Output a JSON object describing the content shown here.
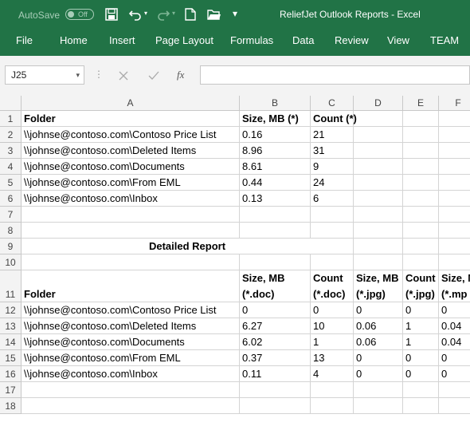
{
  "window": {
    "autosave_label": "AutoSave",
    "autosave_state": "Off",
    "title": "ReliefJet Outlook Reports  -  Excel"
  },
  "ribbon": {
    "tabs": [
      "File",
      "Home",
      "Insert",
      "Page Layout",
      "Formulas",
      "Data",
      "Review",
      "View",
      "TEAM"
    ]
  },
  "formula_bar": {
    "name_box": "J25",
    "fx": "fx",
    "value": ""
  },
  "sheet": {
    "columns": [
      "A",
      "B",
      "C",
      "D",
      "E",
      "F"
    ],
    "rows": [
      {
        "n": "1",
        "cells": [
          "Folder",
          "Size, MB (*)",
          "Count (*)",
          "",
          "",
          ""
        ]
      },
      {
        "n": "2",
        "cells": [
          "\\\\johnse@contoso.com\\Contoso Price List",
          "0.16",
          "21",
          "",
          "",
          ""
        ]
      },
      {
        "n": "3",
        "cells": [
          "\\\\johnse@contoso.com\\Deleted Items",
          "8.96",
          "31",
          "",
          "",
          ""
        ]
      },
      {
        "n": "4",
        "cells": [
          "\\\\johnse@contoso.com\\Documents",
          "8.61",
          "9",
          "",
          "",
          ""
        ]
      },
      {
        "n": "5",
        "cells": [
          "\\\\johnse@contoso.com\\From EML",
          "0.44",
          "24",
          "",
          "",
          ""
        ]
      },
      {
        "n": "6",
        "cells": [
          "\\\\johnse@contoso.com\\Inbox",
          "0.13",
          "6",
          "",
          "",
          ""
        ]
      },
      {
        "n": "7",
        "cells": [
          "",
          "",
          "",
          "",
          "",
          ""
        ]
      },
      {
        "n": "8",
        "cells": [
          "",
          "",
          "",
          "",
          "",
          ""
        ]
      },
      {
        "n": "9",
        "cells": [
          "",
          "",
          "",
          "",
          "",
          ""
        ],
        "merged_title": "Detailed Report"
      },
      {
        "n": "10",
        "cells": [
          "",
          "",
          "",
          "",
          "",
          ""
        ]
      },
      {
        "n": "11",
        "cells": [
          "Folder",
          "Size, MB\n(*.doc)",
          "Count\n(*.doc)",
          "Size, MB\n(*.jpg)",
          "Count\n(*.jpg)",
          "Size, MB\n(*.mp"
        ]
      },
      {
        "n": "12",
        "cells": [
          "\\\\johnse@contoso.com\\Contoso Price List",
          "0",
          "0",
          "0",
          "0",
          "0"
        ]
      },
      {
        "n": "13",
        "cells": [
          "\\\\johnse@contoso.com\\Deleted Items",
          "6.27",
          "10",
          "0.06",
          "1",
          "0.04"
        ]
      },
      {
        "n": "14",
        "cells": [
          "\\\\johnse@contoso.com\\Documents",
          "6.02",
          "1",
          "0.06",
          "1",
          "0.04"
        ]
      },
      {
        "n": "15",
        "cells": [
          "\\\\johnse@contoso.com\\From EML",
          "0.37",
          "13",
          "0",
          "0",
          "0"
        ]
      },
      {
        "n": "16",
        "cells": [
          "\\\\johnse@contoso.com\\Inbox",
          "0.11",
          "4",
          "0",
          "0",
          "0"
        ]
      },
      {
        "n": "17",
        "cells": [
          "",
          "",
          "",
          "",
          "",
          ""
        ]
      },
      {
        "n": "18",
        "cells": [
          "",
          "",
          "",
          "",
          "",
          ""
        ]
      }
    ]
  }
}
